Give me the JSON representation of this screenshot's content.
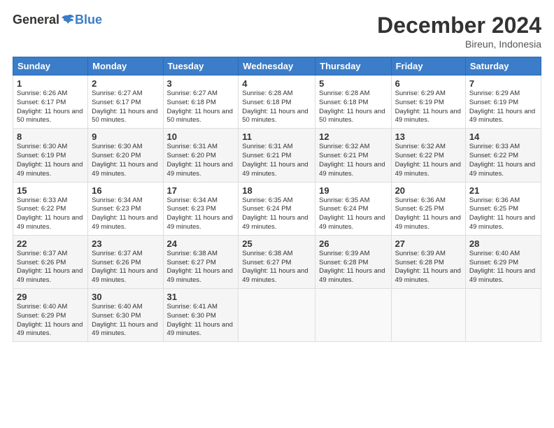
{
  "logo": {
    "general": "General",
    "blue": "Blue"
  },
  "title": "December 2024",
  "location": "Bireun, Indonesia",
  "headers": [
    "Sunday",
    "Monday",
    "Tuesday",
    "Wednesday",
    "Thursday",
    "Friday",
    "Saturday"
  ],
  "weeks": [
    [
      {
        "day": "1",
        "sunrise": "6:26 AM",
        "sunset": "6:17 PM",
        "daylight": "11 hours and 50 minutes."
      },
      {
        "day": "2",
        "sunrise": "6:27 AM",
        "sunset": "6:17 PM",
        "daylight": "11 hours and 50 minutes."
      },
      {
        "day": "3",
        "sunrise": "6:27 AM",
        "sunset": "6:18 PM",
        "daylight": "11 hours and 50 minutes."
      },
      {
        "day": "4",
        "sunrise": "6:28 AM",
        "sunset": "6:18 PM",
        "daylight": "11 hours and 50 minutes."
      },
      {
        "day": "5",
        "sunrise": "6:28 AM",
        "sunset": "6:18 PM",
        "daylight": "11 hours and 50 minutes."
      },
      {
        "day": "6",
        "sunrise": "6:29 AM",
        "sunset": "6:19 PM",
        "daylight": "11 hours and 49 minutes."
      },
      {
        "day": "7",
        "sunrise": "6:29 AM",
        "sunset": "6:19 PM",
        "daylight": "11 hours and 49 minutes."
      }
    ],
    [
      {
        "day": "8",
        "sunrise": "6:30 AM",
        "sunset": "6:19 PM",
        "daylight": "11 hours and 49 minutes."
      },
      {
        "day": "9",
        "sunrise": "6:30 AM",
        "sunset": "6:20 PM",
        "daylight": "11 hours and 49 minutes."
      },
      {
        "day": "10",
        "sunrise": "6:31 AM",
        "sunset": "6:20 PM",
        "daylight": "11 hours and 49 minutes."
      },
      {
        "day": "11",
        "sunrise": "6:31 AM",
        "sunset": "6:21 PM",
        "daylight": "11 hours and 49 minutes."
      },
      {
        "day": "12",
        "sunrise": "6:32 AM",
        "sunset": "6:21 PM",
        "daylight": "11 hours and 49 minutes."
      },
      {
        "day": "13",
        "sunrise": "6:32 AM",
        "sunset": "6:22 PM",
        "daylight": "11 hours and 49 minutes."
      },
      {
        "day": "14",
        "sunrise": "6:33 AM",
        "sunset": "6:22 PM",
        "daylight": "11 hours and 49 minutes."
      }
    ],
    [
      {
        "day": "15",
        "sunrise": "6:33 AM",
        "sunset": "6:22 PM",
        "daylight": "11 hours and 49 minutes."
      },
      {
        "day": "16",
        "sunrise": "6:34 AM",
        "sunset": "6:23 PM",
        "daylight": "11 hours and 49 minutes."
      },
      {
        "day": "17",
        "sunrise": "6:34 AM",
        "sunset": "6:23 PM",
        "daylight": "11 hours and 49 minutes."
      },
      {
        "day": "18",
        "sunrise": "6:35 AM",
        "sunset": "6:24 PM",
        "daylight": "11 hours and 49 minutes."
      },
      {
        "day": "19",
        "sunrise": "6:35 AM",
        "sunset": "6:24 PM",
        "daylight": "11 hours and 49 minutes."
      },
      {
        "day": "20",
        "sunrise": "6:36 AM",
        "sunset": "6:25 PM",
        "daylight": "11 hours and 49 minutes."
      },
      {
        "day": "21",
        "sunrise": "6:36 AM",
        "sunset": "6:25 PM",
        "daylight": "11 hours and 49 minutes."
      }
    ],
    [
      {
        "day": "22",
        "sunrise": "6:37 AM",
        "sunset": "6:26 PM",
        "daylight": "11 hours and 49 minutes."
      },
      {
        "day": "23",
        "sunrise": "6:37 AM",
        "sunset": "6:26 PM",
        "daylight": "11 hours and 49 minutes."
      },
      {
        "day": "24",
        "sunrise": "6:38 AM",
        "sunset": "6:27 PM",
        "daylight": "11 hours and 49 minutes."
      },
      {
        "day": "25",
        "sunrise": "6:38 AM",
        "sunset": "6:27 PM",
        "daylight": "11 hours and 49 minutes."
      },
      {
        "day": "26",
        "sunrise": "6:39 AM",
        "sunset": "6:28 PM",
        "daylight": "11 hours and 49 minutes."
      },
      {
        "day": "27",
        "sunrise": "6:39 AM",
        "sunset": "6:28 PM",
        "daylight": "11 hours and 49 minutes."
      },
      {
        "day": "28",
        "sunrise": "6:40 AM",
        "sunset": "6:29 PM",
        "daylight": "11 hours and 49 minutes."
      }
    ],
    [
      {
        "day": "29",
        "sunrise": "6:40 AM",
        "sunset": "6:29 PM",
        "daylight": "11 hours and 49 minutes."
      },
      {
        "day": "30",
        "sunrise": "6:40 AM",
        "sunset": "6:30 PM",
        "daylight": "11 hours and 49 minutes."
      },
      {
        "day": "31",
        "sunrise": "6:41 AM",
        "sunset": "6:30 PM",
        "daylight": "11 hours and 49 minutes."
      },
      null,
      null,
      null,
      null
    ]
  ]
}
